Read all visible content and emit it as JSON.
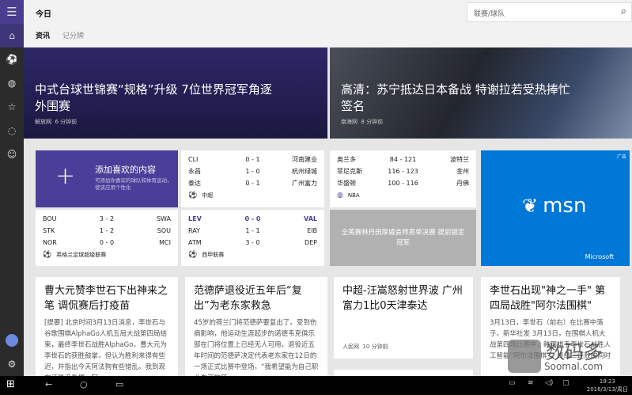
{
  "sidebar": {
    "items": [
      {
        "icon": "hamburger-icon"
      },
      {
        "icon": "home-icon"
      },
      {
        "icon": "soccer-icon"
      },
      {
        "icon": "basketball-icon"
      },
      {
        "icon": "favorites-icon"
      },
      {
        "icon": "volleyball-icon"
      },
      {
        "icon": "smiley-icon"
      },
      {
        "icon": "avatar"
      },
      {
        "icon": "gear-icon"
      }
    ]
  },
  "header": {
    "title": "今日",
    "tabs": [
      "资讯",
      "记分牌"
    ],
    "search_placeholder": "联赛/球队"
  },
  "heroes": [
    {
      "headline": "中式台球世锦赛“规格”升级 7位世界冠军角逐外围赛",
      "source": "解放网",
      "time": "6 分钟前"
    },
    {
      "headline": "高清：苏宁抵达日本备战 特谢拉若受热捧忙签名",
      "source": "南海网",
      "time": "8 分钟前"
    }
  ],
  "add_tile": {
    "title": "添加喜欢的内容",
    "desc": "可添加你喜欢的球队和体育运动，使该应用个性化"
  },
  "csl": {
    "league": "中超",
    "rows": [
      [
        "CLI",
        "0 - 1",
        "河南建业"
      ],
      [
        "永昌",
        "1 - 0",
        "杭州绿城"
      ],
      [
        "泰达",
        "0 - 1",
        "广州富力"
      ]
    ]
  },
  "nba": {
    "league": "NBA",
    "rows": [
      [
        "奥兰多",
        "84 - 121",
        "波特兰"
      ],
      [
        "菲尼克斯",
        "116 - 123",
        "金州"
      ],
      [
        "华盛顿",
        "100 - 116",
        "丹佛"
      ]
    ]
  },
  "epl": {
    "league": "英格兰足球超级联赛",
    "rows": [
      [
        "BOU",
        "3 - 2",
        "SWA"
      ],
      [
        "STK",
        "1 - 2",
        "SOU"
      ],
      [
        "NOR",
        "0 - 0",
        "MCI"
      ]
    ]
  },
  "liga": {
    "league": "西甲联赛",
    "rows": [
      [
        "LEV",
        "0 - 0",
        "VAL"
      ],
      [
        "RAY",
        "1 - 1",
        "EIB"
      ],
      [
        "ATM",
        "3 - 0",
        "DEP"
      ]
    ]
  },
  "gray_tile": {
    "headline": "全英赛林丹田厚威会师男单决赛 提前锁定冠军"
  },
  "ad": {
    "label": "广告",
    "brand": "msn",
    "company": "Microsoft",
    "color": "#0078d7"
  },
  "articles": [
    {
      "headline": "曹大元赞李世石下出神来之笔 调侃赛后打疫苗",
      "body": "[提要] 北京时间3月13日消息，李世石与谷歌围棋AlphaGo人机五局大战第四局结束，最终李世石战胜AlphaGo，曹大元为李世石的获胜鼓掌，但认为胜利来得有些迟，并指出今天阿法狗有些错乱。我到现在还是没看懂，阿"
    },
    {
      "headline": "范德萨退役近五年后“复出”为老东家救急",
      "body": "45岁的荷兰门将范德萨要复出了。受到伤病影响，他运动生涯起步的诺德韦克俱乐部在门将位置上已经无人可用，退役近五年时间的范德萨决定代表老东家在12日的一场正式比赛中登场。“我希望能为自己职业生涯的第"
    },
    {
      "headline": "中超-汪嵩怒射世界波 广州富力1比0天津泰达",
      "source": "人民网",
      "time": "10 分钟前"
    },
    {
      "headline": "李世石出现\"神之一手\" 第四局战胜\"阿尔法围棋\"",
      "body": "3月13日，李世石（前右）在比赛中落子。新华社发 3月13日，在围棋人机大战第四场比赛中，韩国棋手李世石战胜人工智能“阿尔法围棋”，终结三连败的同时"
    }
  ],
  "watermark": {
    "brand": "数码多",
    "site": "Soomal.com"
  },
  "taskbar": {
    "time": "19:23",
    "date": "2016/3/13/周日"
  }
}
